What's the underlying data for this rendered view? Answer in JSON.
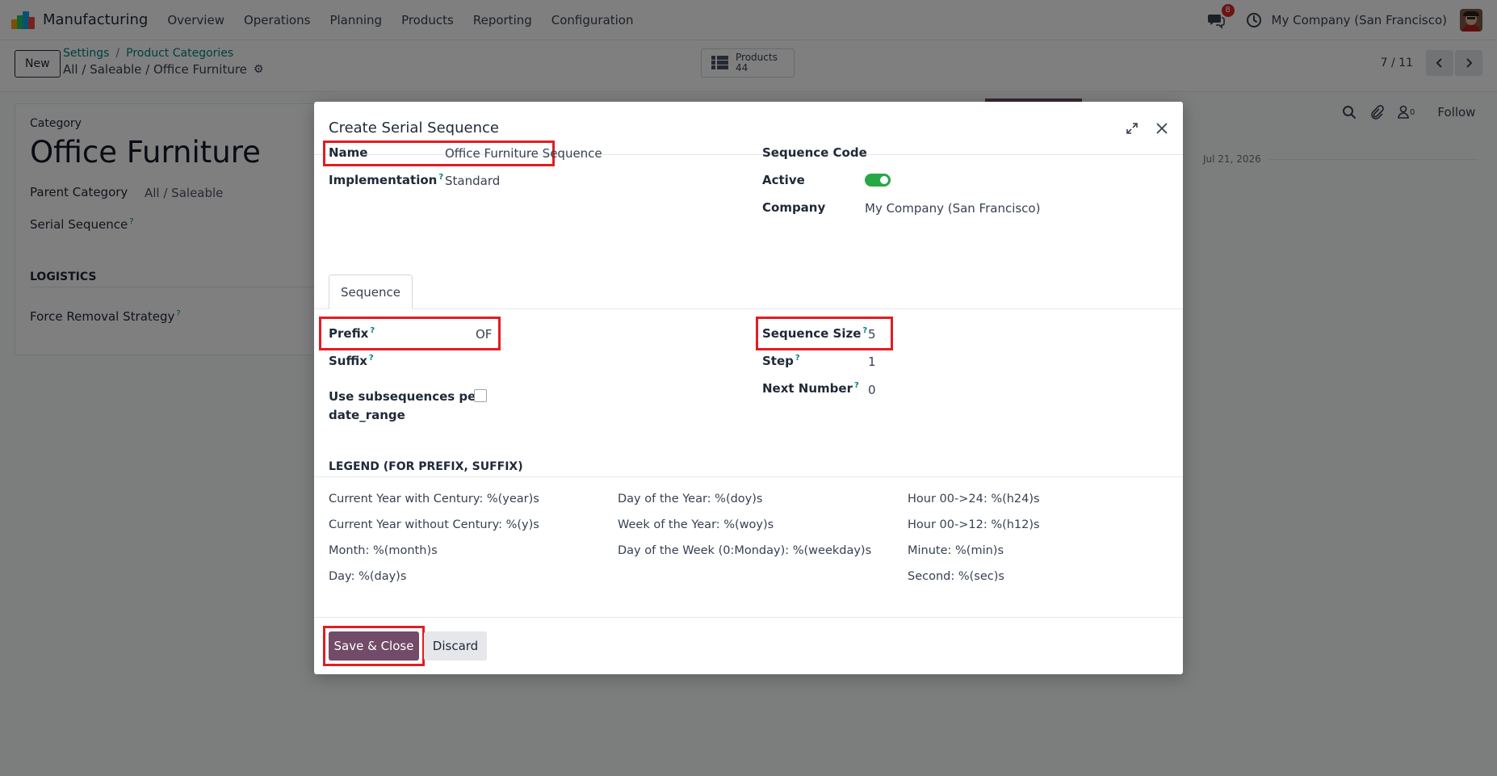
{
  "navbar": {
    "app_name": "Manufacturing",
    "menu": [
      "Overview",
      "Operations",
      "Planning",
      "Products",
      "Reporting",
      "Configuration"
    ],
    "messages_badge": "8",
    "company": "My Company (San Francisco)",
    "icons": [
      "app-logo",
      "chat-icon",
      "clock-icon",
      "avatar"
    ]
  },
  "control_panel": {
    "new_label": "New",
    "breadcrumb": [
      "Settings",
      "Product Categories"
    ],
    "record_path": "All / Saleable / Office Furniture",
    "smart_button": {
      "label": "Products",
      "count": "44"
    },
    "pager": "7 / 11"
  },
  "form": {
    "category_label": "Category",
    "title": "Office Furniture",
    "parent_label": "Parent Category",
    "parent_value": "All / Saleable",
    "serial_label": "Serial Sequence",
    "section": "LOGISTICS",
    "removal_label": "Force Removal Strategy"
  },
  "chatter": {
    "follow": "Follow",
    "followers": "0",
    "date": "Jul 21, 2026"
  },
  "dialog": {
    "title": "Create Serial Sequence",
    "name_label": "Name",
    "name_value": "Office Furniture Sequence",
    "impl_label": "Implementation",
    "impl_value": "Standard",
    "code_label": "Sequence Code",
    "active_label": "Active",
    "active_value": true,
    "company_label": "Company",
    "company_value": "My Company (San Francisco)",
    "tab": "Sequence",
    "prefix_label": "Prefix",
    "prefix_value": "OF",
    "suffix_label": "Suffix",
    "subseq_label_1": "Use subsequences per",
    "subseq_label_2": "date_range",
    "size_label": "Sequence Size",
    "size_value": "5",
    "step_label": "Step",
    "step_value": "1",
    "next_label": "Next Number",
    "next_value": "0",
    "legend_title": "LEGEND (FOR PREFIX, SUFFIX)",
    "legend": [
      [
        "Current Year with Century: %(year)s",
        "Current Year without Century: %(y)s",
        "Month: %(month)s",
        "Day: %(day)s"
      ],
      [
        "Day of the Year: %(doy)s",
        "Week of the Year: %(woy)s",
        "Day of the Week (0:Monday): %(weekday)s"
      ],
      [
        "Hour 00->24: %(h24)s",
        "Hour 00->12: %(h12)s",
        "Minute: %(min)s",
        "Second: %(sec)s"
      ]
    ],
    "save_label": "Save & Close",
    "discard_label": "Discard"
  },
  "colors": {
    "brand": "#714b67",
    "link": "#017e84",
    "highlight": "#e11d23",
    "toggle_on": "#28a745"
  }
}
